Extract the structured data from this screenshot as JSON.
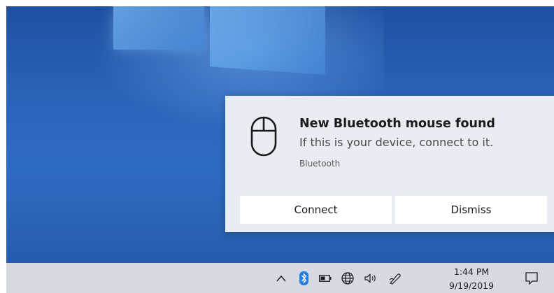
{
  "notification": {
    "title": "New Bluetooth mouse found",
    "body": "If this is your device, connect to it.",
    "source": "Bluetooth",
    "icon": "mouse-icon",
    "buttons": {
      "connect": "Connect",
      "dismiss": "Dismiss"
    }
  },
  "taskbar": {
    "tray_icons": [
      "chevron-up-icon",
      "bluetooth-icon",
      "battery-icon",
      "network-globe-icon",
      "speaker-icon",
      "pen-icon",
      "action-center-icon"
    ],
    "time": "1:44 PM",
    "date": "9/19/2019"
  },
  "colors": {
    "desktop": "#2a63b8",
    "toast_background": "#e9ecf2",
    "button_background": "#ffffff",
    "taskbar": "#d7dae3",
    "bluetooth_accent": "#1f7be0"
  }
}
